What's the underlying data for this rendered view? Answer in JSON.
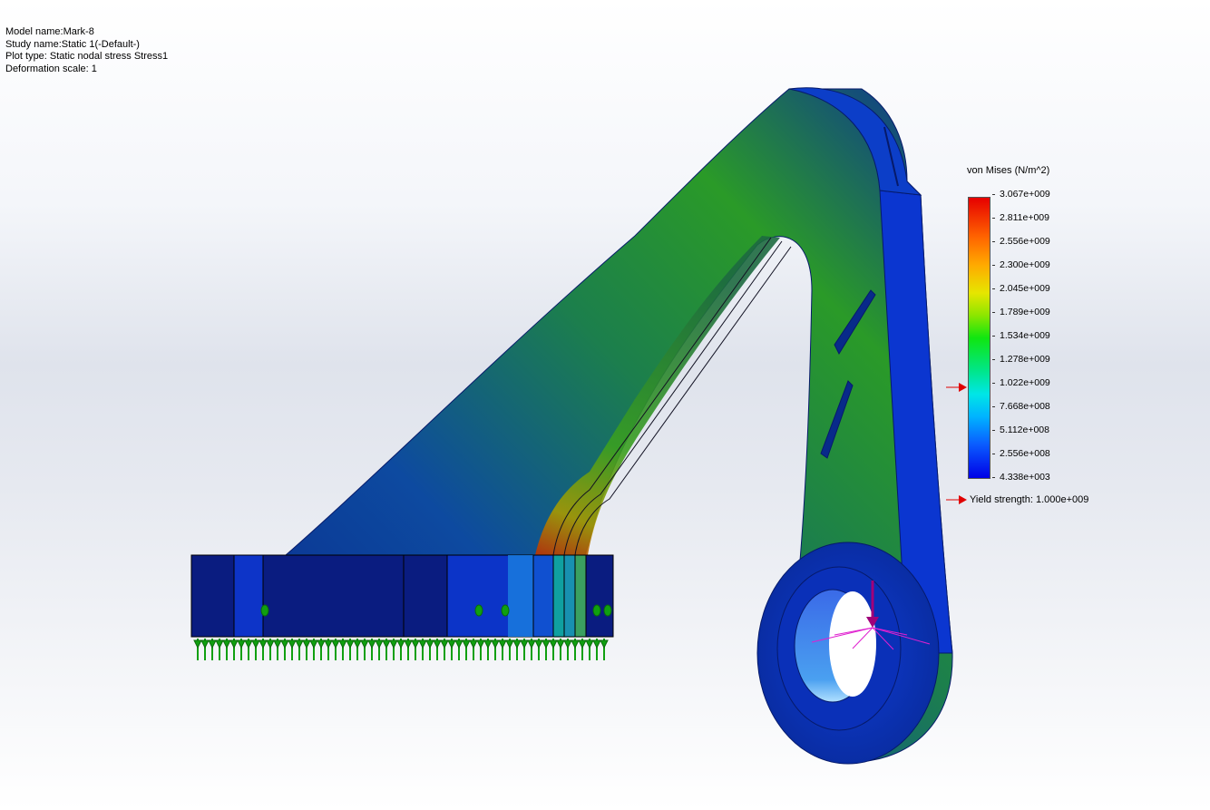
{
  "info": {
    "model_name": "Model name:Mark-8",
    "study_name": "Study name:Static 1(-Default-)",
    "plot_type": "Plot type: Static nodal stress Stress1",
    "deformation_scale": "Deformation scale: 1"
  },
  "legend": {
    "title": "von Mises (N/m^2)",
    "ticks": [
      "3.067e+009",
      "2.811e+009",
      "2.556e+009",
      "2.300e+009",
      "2.045e+009",
      "1.789e+009",
      "1.534e+009",
      "1.278e+009",
      "1.022e+009",
      "7.668e+008",
      "5.112e+008",
      "2.556e+008",
      "4.338e+003"
    ],
    "yield_label": "Yield strength: 1.000e+009",
    "max_color": "#e60000",
    "min_color": "#0000e6",
    "marker_color": "#e00000"
  },
  "icons": {
    "fixture": "fixed-geometry-icon",
    "load": "force-arrow-icon",
    "yield_marker": "red-arrow-icon"
  }
}
